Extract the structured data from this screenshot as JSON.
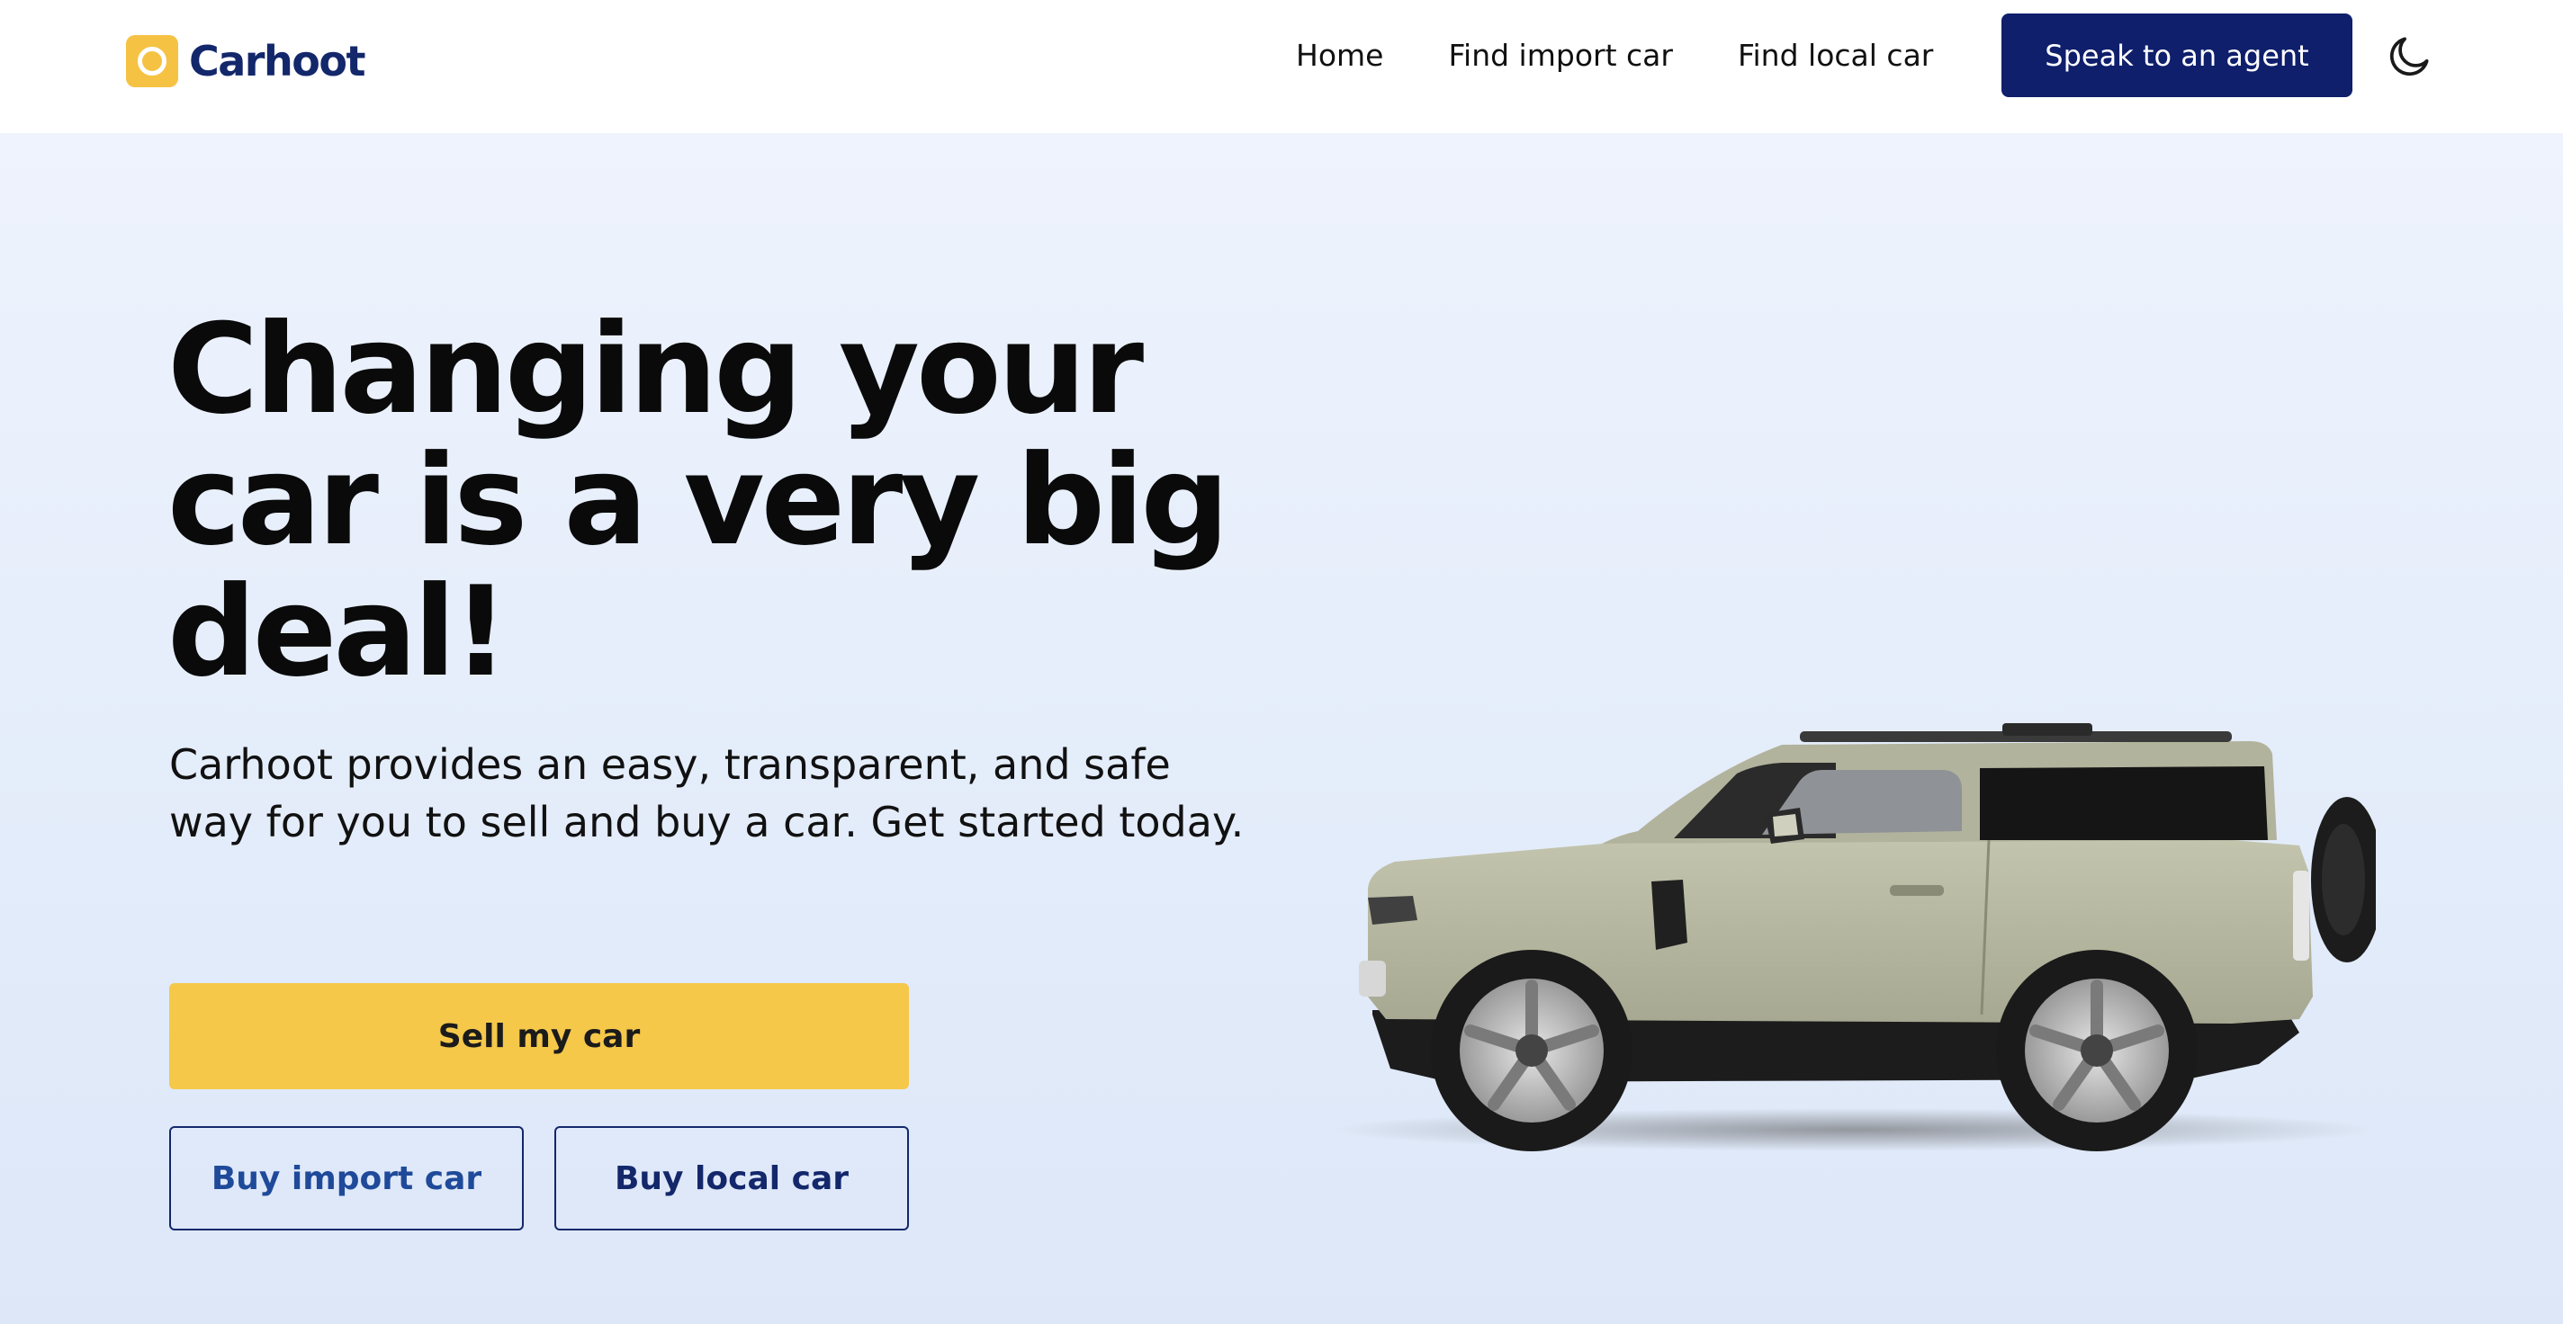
{
  "brand": {
    "name": "Carhoot",
    "accent_color": "#f5c244",
    "primary_color": "#0f1f6b"
  },
  "nav": {
    "links": [
      {
        "label": "Home"
      },
      {
        "label": "Find import car"
      },
      {
        "label": "Find local car"
      }
    ],
    "cta_label": "Speak to an agent",
    "theme_toggle_icon": "moon-icon"
  },
  "hero": {
    "headline": "Changing your car is a very big deal!",
    "subtext": "Carhoot provides an easy, transparent, and safe way for you to sell and buy a car. Get started today.",
    "buttons": {
      "sell": "Sell my car",
      "buy_import": "Buy import car",
      "buy_local": "Buy local car"
    },
    "image_icon": "car-illustration"
  }
}
